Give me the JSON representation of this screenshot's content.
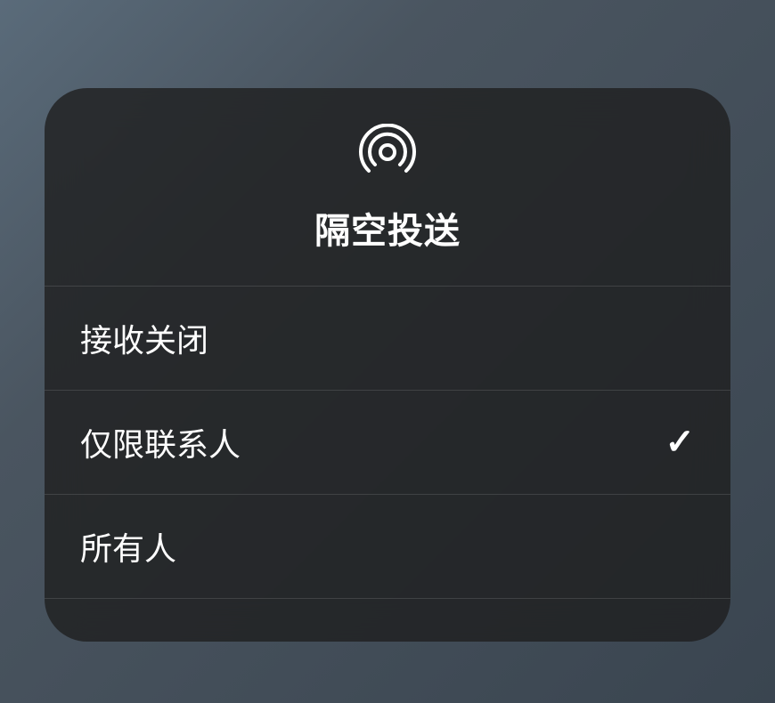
{
  "header": {
    "title": "隔空投送"
  },
  "options": [
    {
      "label": "接收关闭",
      "selected": false
    },
    {
      "label": "仅限联系人",
      "selected": true
    },
    {
      "label": "所有人",
      "selected": false
    }
  ]
}
